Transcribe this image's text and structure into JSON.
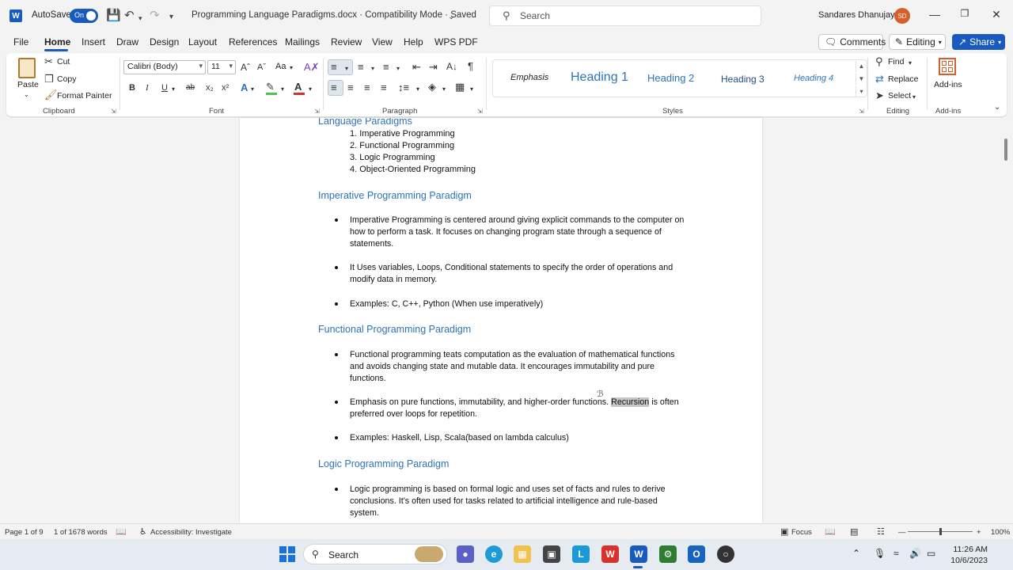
{
  "titlebar": {
    "autosave_label": "AutoSave",
    "autosave_state": "On",
    "document_title": "Programming Language Paradigms.docx  ·  Compatibility Mode  ·  Saved",
    "search_placeholder": "Search",
    "user_name": "Sandares Dhanujaya",
    "user_initials": "SD"
  },
  "menu": {
    "tabs": [
      "File",
      "Home",
      "Insert",
      "Draw",
      "Design",
      "Layout",
      "References",
      "Mailings",
      "Review",
      "View",
      "Help",
      "WPS PDF"
    ],
    "active_tab": "Home",
    "comments_label": "Comments",
    "editing_label": "Editing",
    "share_label": "Share"
  },
  "ribbon": {
    "clipboard": {
      "paste": "Paste",
      "cut": "Cut",
      "copy": "Copy",
      "format_painter": "Format Painter",
      "label": "Clipboard"
    },
    "font": {
      "family": "Calibri (Body)",
      "size": "11",
      "case_label": "Aa",
      "label": "Font"
    },
    "paragraph": {
      "label": "Paragraph"
    },
    "styles": {
      "items": [
        "Emphasis",
        "Heading 1",
        "Heading 2",
        "Heading 3",
        "Heading 4"
      ],
      "label": "Styles"
    },
    "editing": {
      "find": "Find",
      "replace": "Replace",
      "select": "Select",
      "label": "Editing"
    },
    "addins": {
      "button": "Add-ins",
      "label": "Add-ins"
    }
  },
  "document": {
    "partial_heading": "Language Paradigms",
    "numbered_list": [
      "1. Imperative Programming",
      "2. Functional Programming",
      "3. Logic Programming",
      "4. Object-Oriented Programming"
    ],
    "sections": [
      {
        "heading": "Imperative Programming Paradigm",
        "bullets": [
          "Imperative Programming is centered around giving explicit commands to the computer on how to perform a task. It focuses on changing program state through a sequence of statements.",
          "It Uses variables, Loops, Conditional statements to specify the order of operations and modify data in memory.",
          "Examples: C, C++, Python (When use imperatively)"
        ]
      },
      {
        "heading": "Functional Programming Paradigm",
        "bullets": [
          "Functional programming teats computation as the evaluation of mathematical functions and avoids changing state and mutable data. It encourages immutability and pure functions.",
          "Emphasis on pure functions, immutability, and higher-order functions.",
          "Examples: Haskell, Lisp, Scala(based on lambda calculus)"
        ],
        "highlight_word": "Recursion",
        "bullet2_tail": "is often preferred over loops for repetition."
      },
      {
        "heading": "Logic Programming Paradigm",
        "bullets": [
          "Logic programming is based on formal logic and uses set of facts and rules to derive conclusions. It's often used for tasks related to artificial intelligence and rule-based system."
        ]
      }
    ]
  },
  "statusbar": {
    "page": "Page 1 of 9",
    "words": "1 of 1678 words",
    "accessibility": "Accessibility: Investigate",
    "focus": "Focus",
    "zoom": "100%"
  },
  "taskbar": {
    "search_label": "Search",
    "time": "11:26 AM",
    "date": "10/6/2023"
  }
}
